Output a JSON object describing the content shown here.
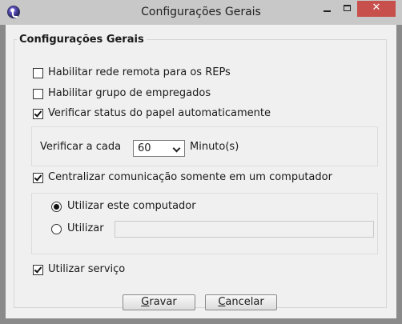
{
  "window": {
    "title": "Configurações Gerais",
    "controls": {
      "minimize": "",
      "maximize": "",
      "close": "✕"
    }
  },
  "group": {
    "title": "Configurações Gerais",
    "options": {
      "rede_remota": {
        "label": "Habilitar rede remota para os REPs",
        "checked": false
      },
      "grupo_empregados": {
        "label": "Habilitar grupo de empregados",
        "checked": false
      },
      "verificar_status": {
        "label": "Verificar status do papel automaticamente",
        "checked": true
      },
      "centralizar": {
        "label": "Centralizar comunicação somente em um computador",
        "checked": true
      },
      "servico": {
        "label": "Utilizar serviço",
        "checked": true
      }
    },
    "verificar_panel": {
      "label": "Verificar a cada",
      "value": "60",
      "unit": "Minuto(s)"
    },
    "computer_panel": {
      "este_computador": {
        "label": "Utilizar este computador",
        "selected": true
      },
      "utilizar": {
        "label": "Utilizar",
        "selected": false,
        "value": ""
      }
    }
  },
  "buttons": {
    "gravar": {
      "prefix": "",
      "accel": "G",
      "rest": "ravar"
    },
    "cancelar": {
      "prefix": "",
      "accel": "C",
      "rest": "ancelar"
    }
  },
  "colors": {
    "frame": "#8a8a8a",
    "titlebar": "#c8c8c8",
    "close": "#c7504c",
    "background": "#f0f0f0"
  }
}
